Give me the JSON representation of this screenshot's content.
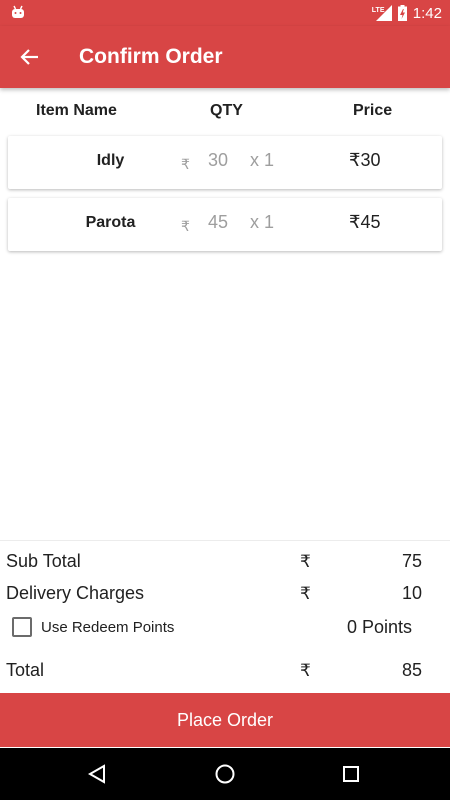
{
  "status_bar": {
    "time": "1:42",
    "network": "LTE"
  },
  "app_bar": {
    "title": "Confirm Order"
  },
  "columns": {
    "item_name": "Item Name",
    "qty": "QTY",
    "price": "Price"
  },
  "items": [
    {
      "name": "Idly",
      "currency": "₹",
      "unit_price": "30",
      "qty": "x 1",
      "total": "₹30"
    },
    {
      "name": "Parota",
      "currency": "₹",
      "unit_price": "45",
      "qty": "x 1",
      "total": "₹45"
    }
  ],
  "summary": {
    "currency": "₹",
    "sub_total_label": "Sub Total",
    "sub_total_value": "75",
    "delivery_label": "Delivery Charges",
    "delivery_value": "10",
    "redeem_label": "Use Redeem Points",
    "redeem_checked": false,
    "points": "0 Points",
    "total_label": "Total",
    "total_value": "85"
  },
  "place_order_label": "Place Order",
  "colors": {
    "primary": "#d84545",
    "muted": "#9e9e9e"
  },
  "icons": {
    "back": "arrow-back-icon",
    "status_app": "android-icon",
    "nav": [
      "back-triangle-icon",
      "home-circle-icon",
      "recents-square-icon"
    ]
  }
}
